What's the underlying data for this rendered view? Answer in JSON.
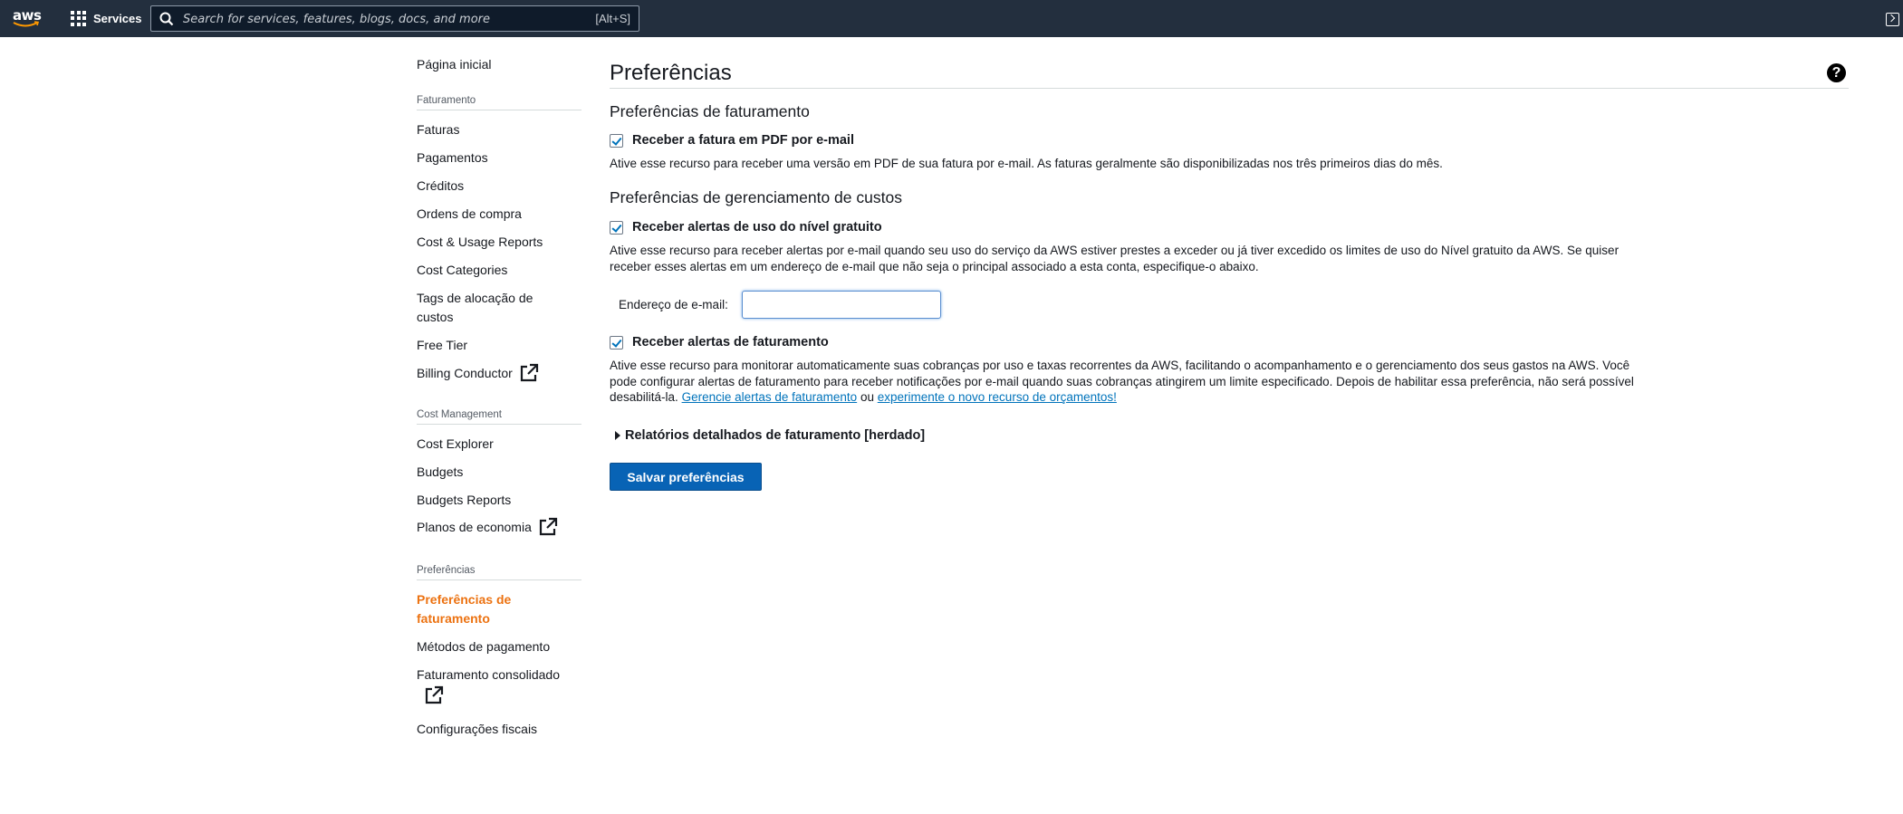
{
  "topnav": {
    "logo_text": "aws",
    "services_label": "Services",
    "search_placeholder": "Search for services, features, blogs, docs, and more",
    "search_shortcut": "[Alt+S]"
  },
  "sidebar": {
    "home": "Página inicial",
    "section_billing": "Faturamento",
    "billing_items": [
      "Faturas",
      "Pagamentos",
      "Créditos",
      "Ordens de compra",
      "Cost & Usage Reports",
      "Cost Categories",
      "Tags de alocação de custos",
      "Free Tier",
      "Billing Conductor"
    ],
    "section_cost_management": "Cost Management",
    "cost_items": [
      "Cost Explorer",
      "Budgets",
      "Budgets Reports",
      "Planos de economia"
    ],
    "section_preferences": "Preferências",
    "preference_items": [
      "Preferências de faturamento",
      "Métodos de pagamento",
      "Faturamento consolidado",
      "Configurações fiscais"
    ]
  },
  "main": {
    "page_title": "Preferências",
    "billing_prefs_title": "Preferências de faturamento",
    "pdf_invoice_label": "Receber a fatura em PDF por e-mail",
    "pdf_invoice_checked": true,
    "pdf_invoice_desc": "Ative esse recurso para receber uma versão em PDF de sua fatura por e-mail. As faturas geralmente são disponibilizadas nos três primeiros dias do mês.",
    "cost_mgmt_title": "Preferências de gerenciamento de custos",
    "free_tier_label": "Receber alertas de uso do nível gratuito",
    "free_tier_checked": true,
    "free_tier_desc": "Ative esse recurso para receber alertas por e-mail quando seu uso do serviço da AWS estiver prestes a exceder ou já tiver excedido os limites de uso do Nível gratuito da AWS. Se quiser receber esses alertas em um endereço de e-mail que não seja o principal associado a esta conta, especifique-o abaixo.",
    "email_label": "Endereço de e-mail:",
    "email_value": "",
    "billing_alerts_label": "Receber alertas de faturamento",
    "billing_alerts_checked": true,
    "billing_alerts_desc": "Ative esse recurso para monitorar automaticamente suas cobranças por uso e taxas recorrentes da AWS, facilitando o acompanhamento e o gerenciamento dos seus gastos na AWS. Você pode configurar alertas de faturamento para receber notificações por e-mail quando suas cobranças atingirem um limite especificado. Depois de habilitar essa preferência, não será possível desabilitá-la.",
    "link_manage_alerts": "Gerencie alertas de faturamento",
    "or_text": "ou",
    "link_budgets": "experimente o novo recurso de orçamentos!",
    "detailed_reports_label": "Relatórios detalhados de faturamento [herdado]",
    "save_label": "Salvar preferências",
    "help_glyph": "?"
  },
  "colors": {
    "nav_bg": "#232f3e",
    "active_orange": "#ec7211",
    "primary_blue": "#0863b5",
    "link_blue": "#0073bb"
  },
  "icons": [
    "aws-logo",
    "services-grid-icon",
    "search-icon",
    "cloudshell-icon",
    "help-icon",
    "external-link-icon",
    "checkbox-checked",
    "caret-right-icon"
  ]
}
